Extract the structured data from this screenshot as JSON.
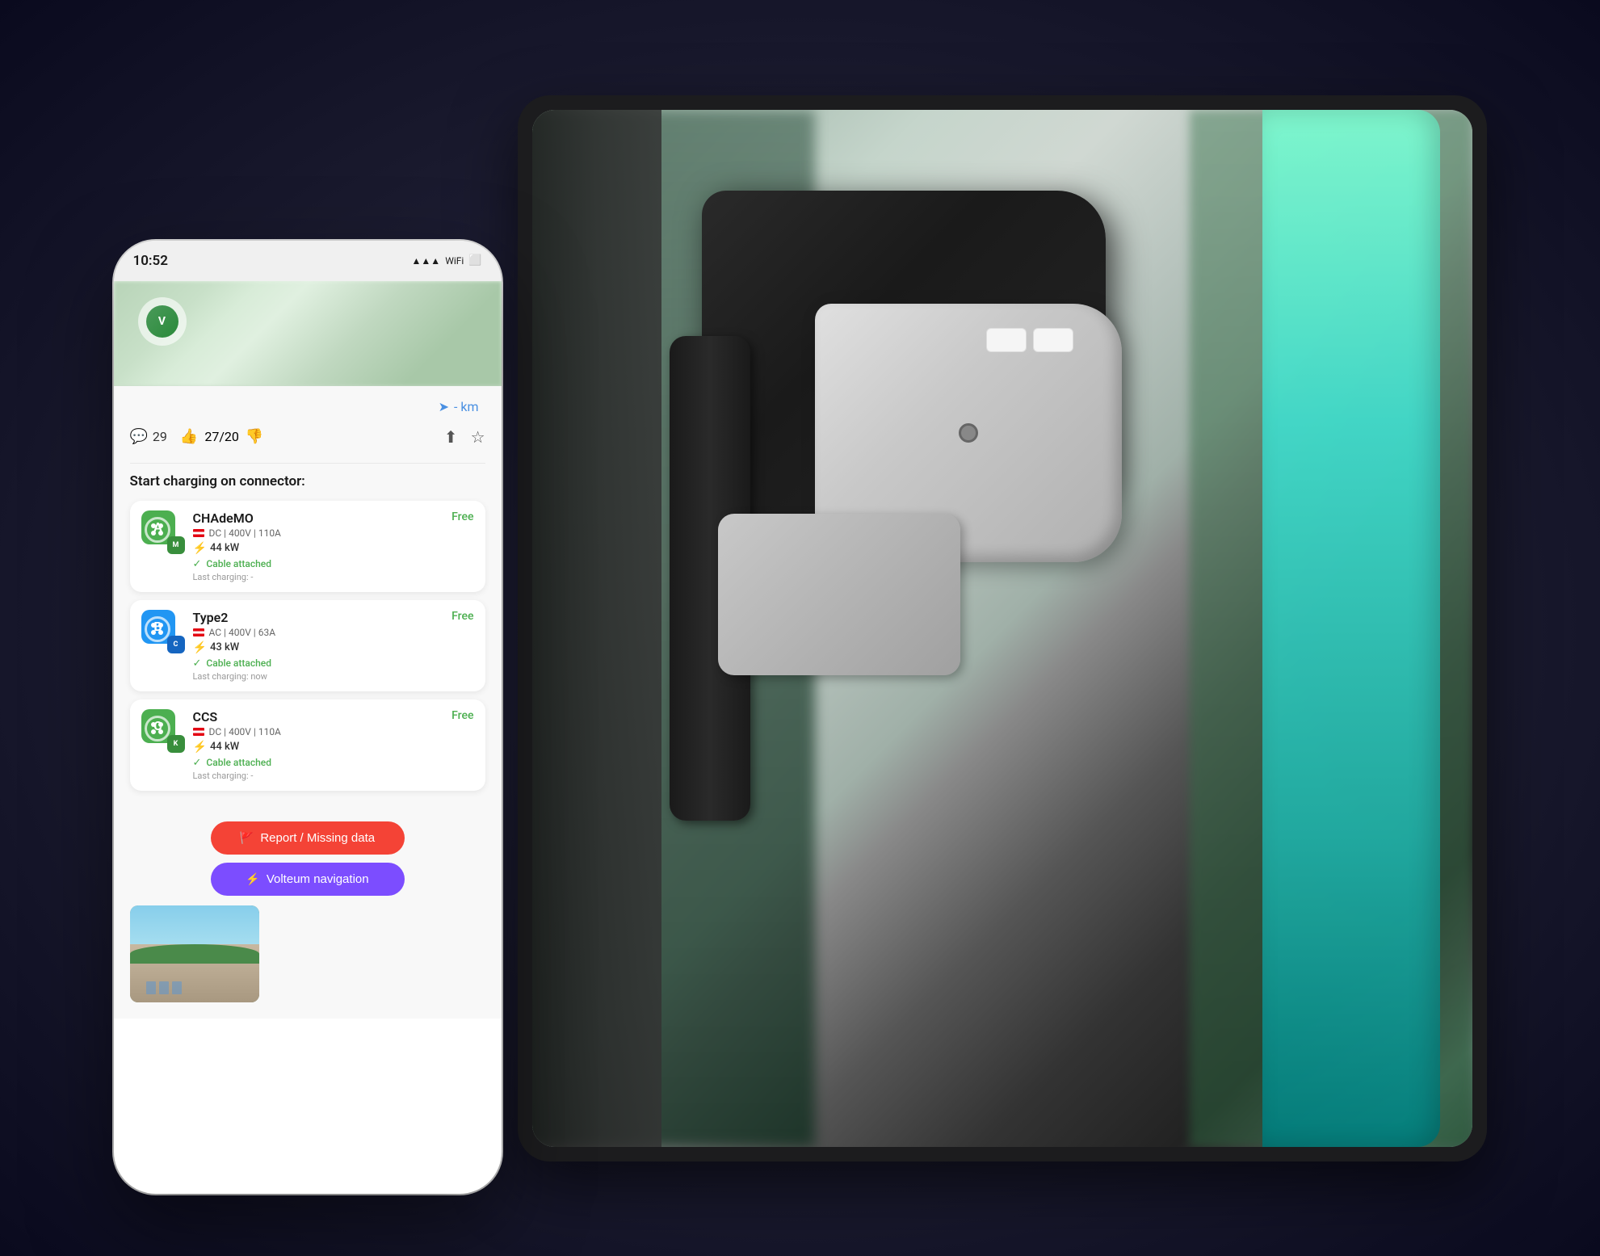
{
  "scene": {
    "background_color": "#1a1a2e"
  },
  "phone": {
    "time": "10:52",
    "status_icons": [
      "signal",
      "wifi",
      "battery"
    ],
    "distance": "- km",
    "comments_count": "29",
    "thumbs_up": "27/20",
    "section_title": "Start charging on connector:",
    "connectors": [
      {
        "id": "A",
        "name": "CHAdeMO",
        "type_label": "DC | 400V | 110A",
        "status": "Free",
        "power": "44 kW",
        "cable": "Cable attached",
        "last_charging": "Last charging: -",
        "icon_color": "green",
        "badge_letter": "M",
        "badge_color": "dark-green"
      },
      {
        "id": "B",
        "name": "Type2",
        "type_label": "AC | 400V | 63A",
        "status": "Free",
        "power": "43 kW",
        "cable": "Cable attached",
        "last_charging": "Last charging: now",
        "icon_color": "blue",
        "badge_letter": "C",
        "badge_color": "dark-blue"
      },
      {
        "id": "C",
        "name": "CCS",
        "type_label": "DC | 400V | 110A",
        "status": "Free",
        "power": "44 kW",
        "cable": "Cable attached",
        "last_charging": "Last charging: -",
        "icon_color": "green",
        "badge_letter": "K",
        "badge_color": "dark-green"
      }
    ],
    "report_button": "Report / Missing data",
    "volteum_button": "Volteum navigation"
  }
}
